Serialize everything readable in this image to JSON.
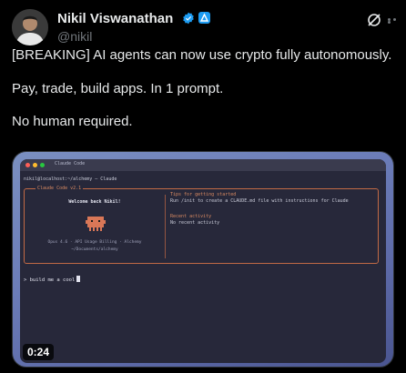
{
  "author": {
    "name": "Nikil Viswanathan",
    "handle": "@nikil"
  },
  "tweet": {
    "lines": [
      "[BREAKING] AI agents can now use crypto fully autonomously.",
      "Pay, trade, build apps. In 1 prompt.",
      "No human required."
    ]
  },
  "media": {
    "duration": "0:24",
    "terminal": {
      "window_title": "Claude Code",
      "path_line": "nikil@localhost:~/alchemy — Claude",
      "panel_label": "Claude Code v2.1",
      "welcome": "Welcome back Nikil!",
      "model_line": "Opus 4.6 · API Usage Billing · Alchemy",
      "cwd": "~/Documents/alchemy",
      "tips_title": "Tips for getting started",
      "tips_body": "Run /init to create a CLAUDE.md file with instructions for Claude",
      "recent_title": "Recent activity",
      "recent_body": "No recent activity",
      "prompt": "> build me a cool"
    }
  },
  "colors": {
    "accent": "#1d9bf0",
    "terminal_bg": "#27283a",
    "terminal_accent": "#c26a45"
  }
}
